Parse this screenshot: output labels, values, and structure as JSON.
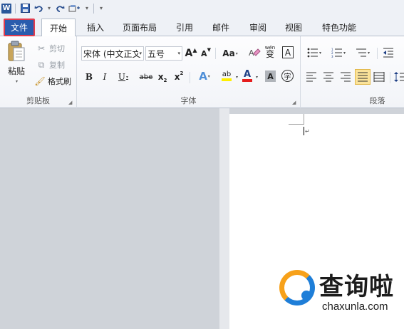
{
  "qat": {
    "app_icon": "W",
    "save_icon": "save-icon",
    "undo_icon": "undo-icon",
    "redo_icon": "redo-icon",
    "customize_icon": "customize-icon"
  },
  "tabs": [
    {
      "label": "文件"
    },
    {
      "label": "开始"
    },
    {
      "label": "插入"
    },
    {
      "label": "页面布局"
    },
    {
      "label": "引用"
    },
    {
      "label": "邮件"
    },
    {
      "label": "审阅"
    },
    {
      "label": "视图"
    },
    {
      "label": "特色功能"
    }
  ],
  "clipboard": {
    "group_label": "剪贴板",
    "paste": "粘贴",
    "cut": "剪切",
    "copy": "复制",
    "format_painter": "格式刷"
  },
  "font": {
    "group_label": "字体",
    "font_name": "宋体 (中文正文",
    "font_size": "五号",
    "grow": "A",
    "shrink": "A",
    "change_case": "Aa",
    "clear": "A",
    "phonetic": "wén",
    "phonetic_char": "变",
    "border_char": "A",
    "bold": "B",
    "italic": "I",
    "underline": "U",
    "strike": "abe",
    "subscript": "x",
    "superscript": "x",
    "effects": "A",
    "highlight": "ab",
    "font_color": "A",
    "shading": "A",
    "enclose": "字"
  },
  "paragraph": {
    "group_label": "段落"
  },
  "watermark": {
    "title": "查询啦",
    "url": "chaxunla.com"
  },
  "colors": {
    "file_tab": "#2a5cad",
    "highlight_box": "#e23b4d",
    "logo_orange": "#f7a11a",
    "logo_blue": "#1e7ed8"
  }
}
